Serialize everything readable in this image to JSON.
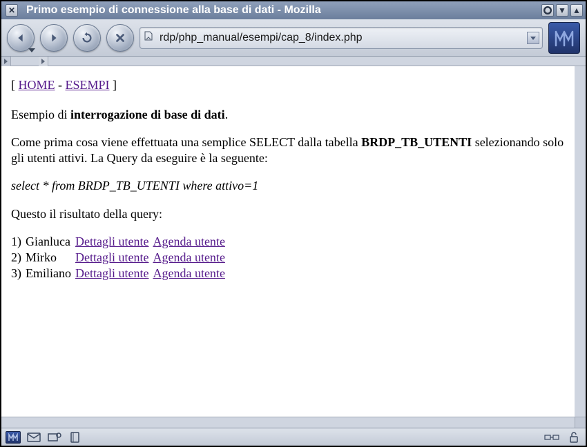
{
  "window": {
    "title": "Primo esempio di connessione alla base di dati - Mozilla"
  },
  "urlbar": {
    "value": "rdp/php_manual/esempi/cap_8/index.php"
  },
  "content": {
    "breadcrumb": {
      "open": "[ ",
      "home": "HOME",
      "sep": " - ",
      "esempi": "ESEMPI",
      "close": " ]"
    },
    "line1_pre": "Esempio di ",
    "line1_bold": "interrogazione di base di dati",
    "line1_post": ".",
    "line2_pre": "Come prima cosa viene effettuata una semplice SELECT dalla tabella ",
    "line2_bold": "BRDP_TB_UTENTI",
    "line2_post": " selezionando solo gli utenti attivi. La Query da eseguire è la seguente:",
    "query": "select * from BRDP_TB_UTENTI where attivo=1",
    "result_intro": "Questo il risultato della query:",
    "rows": [
      {
        "idx": "1)",
        "name": "Gianluca",
        "detail": "Dettagli utente",
        "agenda": "Agenda utente"
      },
      {
        "idx": "2)",
        "name": "Mirko",
        "detail": "Dettagli utente",
        "agenda": "Agenda utente"
      },
      {
        "idx": "3)",
        "name": "Emiliano",
        "detail": "Dettagli utente",
        "agenda": "Agenda utente"
      }
    ]
  }
}
